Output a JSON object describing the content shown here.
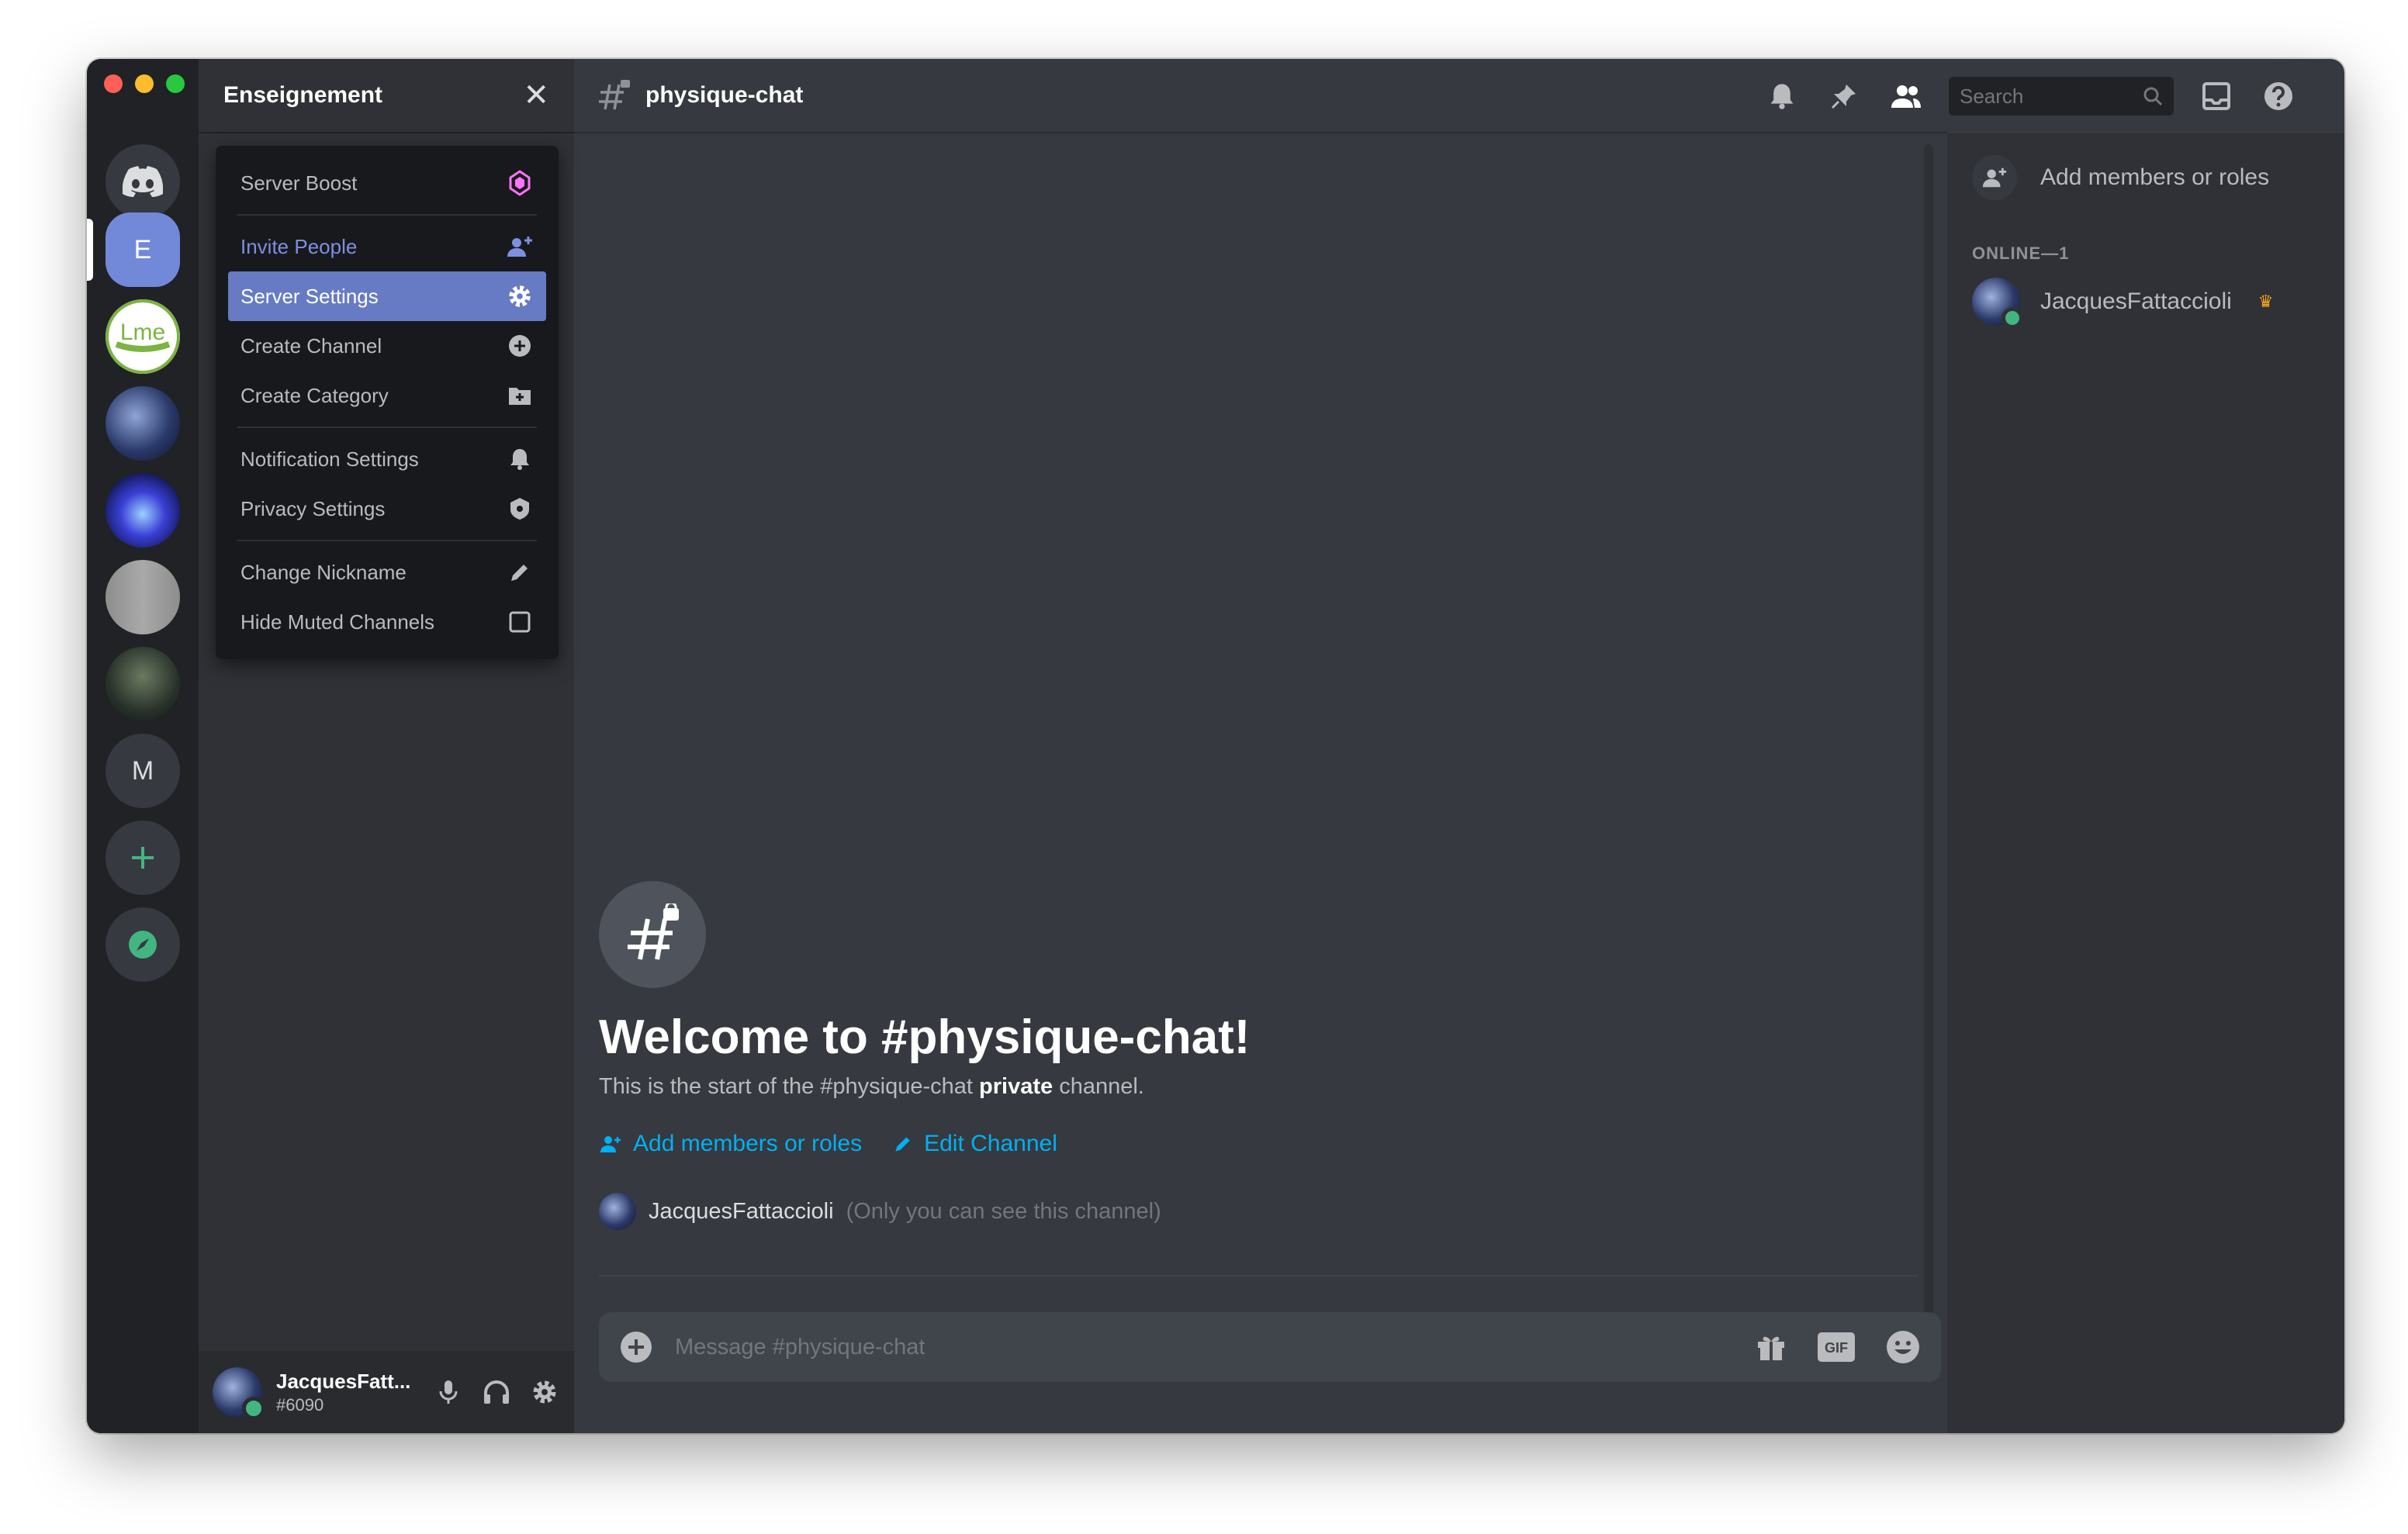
{
  "server": {
    "name": "Enseignement",
    "rail": {
      "e_label": "E",
      "lme_label": "Lme",
      "m_label": "M"
    }
  },
  "menu": {
    "items": [
      {
        "label": "Server Boost",
        "icon": "boost-icon"
      },
      {
        "label": "Invite People",
        "icon": "add-user-icon"
      },
      {
        "label": "Server Settings",
        "icon": "gear-icon"
      },
      {
        "label": "Create Channel",
        "icon": "plus-circle-icon"
      },
      {
        "label": "Create Category",
        "icon": "folder-plus-icon"
      },
      {
        "label": "Notification Settings",
        "icon": "bell-icon"
      },
      {
        "label": "Privacy Settings",
        "icon": "shield-icon"
      },
      {
        "label": "Change Nickname",
        "icon": "pencil-icon"
      },
      {
        "label": "Hide Muted Channels",
        "icon": "checkbox-icon"
      }
    ]
  },
  "user": {
    "name": "JacquesFatt...",
    "tag": "#6090"
  },
  "channel": {
    "name": "physique-chat"
  },
  "header": {
    "search_placeholder": "Search"
  },
  "welcome": {
    "title": "Welcome to #physique-chat!",
    "desc_prefix": "This is the start of the #physique-chat",
    "desc_bold": "private",
    "desc_suffix": "channel.",
    "add_members": "Add members or roles",
    "edit_channel": "Edit Channel",
    "owner_name": "JacquesFattaccioli",
    "owner_note": "(Only you can see this channel)"
  },
  "composer": {
    "placeholder": "Message #physique-chat",
    "gif_label": "GIF"
  },
  "members": {
    "add_label": "Add members or roles",
    "online_header": "ONLINE—1",
    "list": [
      {
        "name": "JacquesFattaccioli",
        "role_badge": "crown-icon"
      }
    ]
  },
  "colors": {
    "accent": "#7289da",
    "link": "#00b0f4",
    "online": "#43b581",
    "boost": "#ff73fa"
  }
}
